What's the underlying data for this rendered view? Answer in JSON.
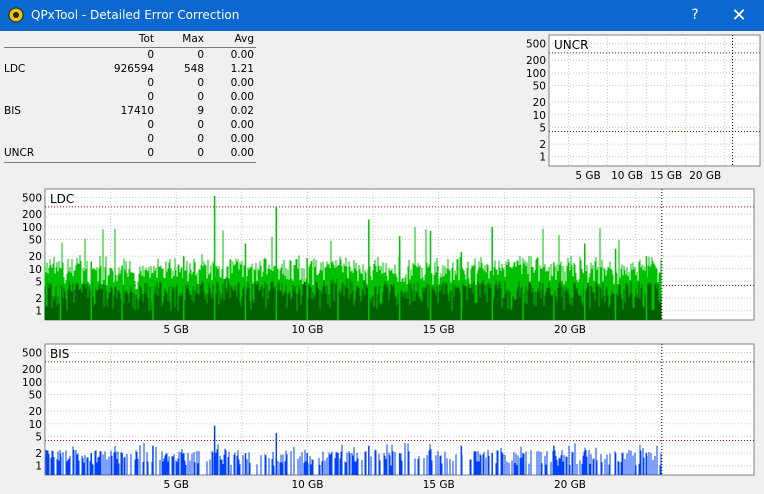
{
  "window": {
    "title": "QPxTool - Detailed Error Correction",
    "help_label": "?",
    "close_label": "✕"
  },
  "stats_table": {
    "headers": [
      "",
      "Tot",
      "Max",
      "Avg"
    ],
    "rows": [
      [
        "",
        "0",
        "0",
        "0.00"
      ],
      [
        "LDC",
        "926594",
        "548",
        "1.21"
      ],
      [
        "",
        "0",
        "0",
        "0.00"
      ],
      [
        "",
        "0",
        "0",
        "0.00"
      ],
      [
        "BIS",
        "17410",
        "9",
        "0.02"
      ],
      [
        "",
        "0",
        "0",
        "0.00"
      ],
      [
        "",
        "0",
        "0",
        "0.00"
      ],
      [
        "UNCR",
        "0",
        "0",
        "0.00"
      ]
    ]
  },
  "colors": {
    "titlebar": "#0a68d0",
    "ldc_light": "#00c000",
    "ldc_dark": "#006000",
    "bis": "#0040ff",
    "threshold": "#cc0000",
    "grid": "#c8c8c8"
  },
  "chart_data": [
    {
      "type": "bar",
      "title": "UNCR",
      "xlabel": "",
      "ylabel": "",
      "y_scale": "log",
      "y_ticks": [
        "500",
        "200",
        "100",
        "50",
        "20",
        "10",
        "5",
        "2",
        "1"
      ],
      "x_ticks": [
        "5 GB",
        "10 GB",
        "15 GB",
        "20 GB"
      ],
      "x_range_gb": [
        0,
        23.5
      ],
      "series": [
        {
          "values": []
        }
      ]
    },
    {
      "type": "bar",
      "title": "LDC",
      "xlabel": "",
      "ylabel": "",
      "y_scale": "log",
      "y_ticks": [
        "500",
        "200",
        "100",
        "50",
        "20",
        "10",
        "5",
        "2",
        "1"
      ],
      "x_ticks": [
        "5 GB",
        "10 GB",
        "15 GB",
        "20 GB"
      ],
      "x_range_gb": [
        0,
        23.5
      ],
      "series": [
        {
          "values": [
            10,
            15,
            12,
            8,
            20,
            548,
            40,
            300,
            18,
            12,
            150,
            60,
            80,
            25,
            100,
            10,
            14,
            40,
            30,
            20
          ]
        },
        {
          "values": [
            4,
            4,
            3,
            4,
            4,
            5,
            4,
            4,
            4,
            5,
            4,
            4,
            4,
            4,
            5,
            4,
            4,
            4,
            4,
            4
          ]
        }
      ],
      "max": 548
    },
    {
      "type": "bar",
      "title": "BIS",
      "xlabel": "",
      "ylabel": "",
      "y_scale": "log",
      "y_ticks": [
        "500",
        "200",
        "100",
        "50",
        "20",
        "10",
        "5",
        "2",
        "1"
      ],
      "x_ticks": [
        "5 GB",
        "10 GB",
        "15 GB",
        "20 GB"
      ],
      "x_range_gb": [
        0,
        23.5
      ],
      "series": [
        {
          "values": [
            2,
            2,
            2,
            3,
            2,
            9,
            2,
            6,
            2,
            2,
            3,
            2,
            2,
            3,
            2,
            2,
            3,
            2,
            2,
            2
          ]
        }
      ],
      "max": 9
    }
  ]
}
